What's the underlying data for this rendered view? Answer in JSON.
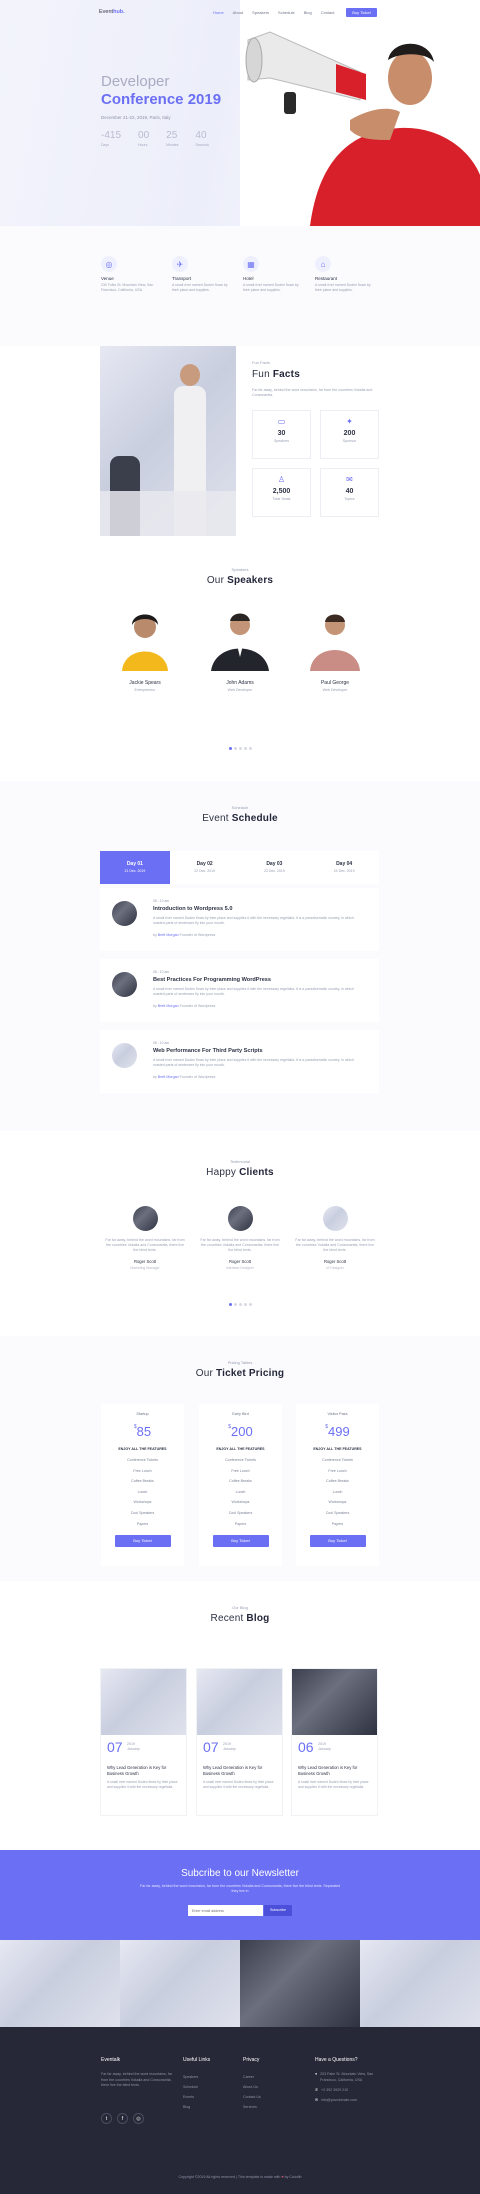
{
  "header": {
    "logo_main": "Event",
    "logo_accent": "hub.",
    "nav": [
      "Home",
      "About",
      "Speakers",
      "Schedule",
      "Blog",
      "Contact"
    ],
    "cta": "Buy Ticket"
  },
  "hero": {
    "title_line1": "Developer",
    "title_line2": "Conference 2019",
    "date": "December 21-22, 2019, Paris, Italy",
    "countdown": [
      {
        "value": "-415",
        "label": "Days"
      },
      {
        "value": "00",
        "label": "Hours"
      },
      {
        "value": "25",
        "label": "Minutes"
      },
      {
        "value": "40",
        "label": "Seconds"
      }
    ]
  },
  "features": [
    {
      "icon": "venue-icon",
      "glyph": "◎",
      "title": "Venue",
      "desc": "230 Folks St. Mountain View, San Francisco, California, USA"
    },
    {
      "icon": "transport-icon",
      "glyph": "✈",
      "title": "Transport",
      "desc": "A small river named Duden flows by their place and supplies."
    },
    {
      "icon": "hotel-icon",
      "glyph": "▦",
      "title": "Hotel",
      "desc": "A small river named Duden flows by their place and supplies."
    },
    {
      "icon": "restaurant-icon",
      "glyph": "⌂",
      "title": "Restaurant",
      "desc": "A small river named Duden flows by their place and supplies."
    }
  ],
  "facts": {
    "kicker": "Fun Facts",
    "title_light": "Fun",
    "title_bold": "Facts",
    "desc": "Far far away, behind the word mountains, far from the countries Vokalia and Consonantia.",
    "items": [
      {
        "icon": "ticket-icon",
        "glyph": "▭",
        "number": "30",
        "label": "Speakers"
      },
      {
        "icon": "sponsor-icon",
        "glyph": "✦",
        "number": "200",
        "label": "Sponsor"
      },
      {
        "icon": "seat-icon",
        "glyph": "♙",
        "number": "2,500",
        "label": "Total Seats"
      },
      {
        "icon": "topics-icon",
        "glyph": "✉",
        "number": "40",
        "label": "Topics"
      }
    ]
  },
  "speakers": {
    "kicker": "Speakers",
    "title_light": "Our",
    "title_bold": "Speakers",
    "items": [
      {
        "name": "Jackie Spears",
        "role": "Entrepreneur"
      },
      {
        "name": "John Adams",
        "role": "Web Developer"
      },
      {
        "name": "Paul George",
        "role": "Web Developer"
      }
    ]
  },
  "schedule": {
    "kicker": "Schedule",
    "title_light": "Event",
    "title_bold": "Schedule",
    "tabs": [
      {
        "day": "Day 01",
        "date": "21 Dec. 2019"
      },
      {
        "day": "Day 02",
        "date": "22 Dec. 2019"
      },
      {
        "day": "Day 03",
        "date": "23 Dec. 2019"
      },
      {
        "day": "Day 04",
        "date": "24 Dec. 2019"
      }
    ],
    "sessions": [
      {
        "time": "08 - 10 am",
        "title": "Introduction to Wordpress 5.0",
        "desc": "A small river named Duden flows by their place and supplies it with the necessary regelialia. It is a paradisematic country, in which roasted parts of sentences fly into your mouth.",
        "by_label": "by",
        "speaker": "Brett Morgan",
        "speaker_role": "Founder of Wordpress"
      },
      {
        "time": "08 - 10 am",
        "title": "Best Practices For Programming WordPress",
        "desc": "A small river named Duden flows by their place and supplies it with the necessary regelialia. It is a paradisematic country, in which roasted parts of sentences fly into your mouth.",
        "by_label": "by",
        "speaker": "Brett Morgan",
        "speaker_role": "Founder of Wordpress"
      },
      {
        "time": "08 - 10 am",
        "title": "Web Performance For Third Party Scripts",
        "desc": "A small river named Duden flows by their place and supplies it with the necessary regelialia. It is a paradisematic country, in which roasted parts of sentences fly into your mouth.",
        "by_label": "by",
        "speaker": "Brett Morgan",
        "speaker_role": "Founder of Wordpress"
      }
    ]
  },
  "clients": {
    "kicker": "Testimonial",
    "title_light": "Happy",
    "title_bold": "Clients",
    "items": [
      {
        "quote": "Far far away, behind the word mountains, far from the countries Vokalia and Consonantia, there live the blind texts.",
        "name": "Roger Scott",
        "role": "Marketing Manager"
      },
      {
        "quote": "Far far away, behind the word mountains, far from the countries Vokalia and Consonantia, there live the blind texts.",
        "name": "Roger Scott",
        "role": "Interface Designer"
      },
      {
        "quote": "Far far away, behind the word mountains, far from the countries Vokalia and Consonantia, there live the blind texts.",
        "name": "Roger Scott",
        "role": "UI Designer"
      }
    ]
  },
  "pricing": {
    "kicker": "Pricing Tables",
    "title_light": "Our",
    "title_bold": "Ticket Pricing",
    "plans": [
      {
        "name": "Startup",
        "currency": "$",
        "price": "85",
        "entry": "ENJOY ALL THE FEATURES",
        "features": [
          "Conference Tickets",
          "Free Lunch",
          "Coffee Breaks",
          "Lunch",
          "Workshops",
          "Cool Speakers",
          "Papers"
        ],
        "button": "Buy Ticket"
      },
      {
        "name": "Early Bird",
        "currency": "$",
        "price": "200",
        "entry": "ENJOY ALL THE FEATURES",
        "features": [
          "Conference Tickets",
          "Free Lunch",
          "Coffee Breaks",
          "Lunch",
          "Workshops",
          "Cool Speakers",
          "Papers"
        ],
        "button": "Buy Ticket"
      },
      {
        "name": "Visitor Pass",
        "currency": "$",
        "price": "499",
        "entry": "ENJOY ALL THE FEATURES",
        "features": [
          "Conference Tickets",
          "Free Lunch",
          "Coffee Breaks",
          "Lunch",
          "Workshops",
          "Cool Speakers",
          "Papers"
        ],
        "button": "Buy Ticket"
      }
    ]
  },
  "blog": {
    "kicker": "Our Blog",
    "title_light": "Recent",
    "title_bold": "Blog",
    "posts": [
      {
        "day": "07",
        "year": "2019",
        "month": "January",
        "title": "Why Lead Generation is Key for Business Growth",
        "desc": "A small river named Duden flows by their place and supplies it with the necessary regelialia."
      },
      {
        "day": "07",
        "year": "2019",
        "month": "January",
        "title": "Why Lead Generation is Key for Business Growth",
        "desc": "A small river named Duden flows by their place and supplies it with the necessary regelialia."
      },
      {
        "day": "06",
        "year": "2019",
        "month": "January",
        "title": "Why Lead Generation is Key for Business Growth",
        "desc": "A small river named Duden flows by their place and supplies it with the necessary regelialia."
      }
    ]
  },
  "newsletter": {
    "title": "Subcribe to our Newsletter",
    "desc": "Far far away, behind the word mountains, far from the countries Vokalia and Consonantia, there live the blind texts. Separated they live in",
    "placeholder": "Enter email address",
    "button": "Subscribe"
  },
  "footer": {
    "about_title": "Eventalk",
    "about_text": "Far far away, behind the word mountains, far from the countries Vokalia and Consonantia, there live the blind texts.",
    "social": [
      "twitter-icon",
      "facebook-icon",
      "instagram-icon"
    ],
    "useful_title": "Useful Links",
    "useful_links": [
      "Speakers",
      "Schedule",
      "Events",
      "Blog"
    ],
    "privacy_title": "Privacy",
    "privacy_links": [
      "Career",
      "About Us",
      "Contact Us",
      "Services"
    ],
    "question_title": "Have a Questions?",
    "address": "203 Fake St. Mountain View, San Francisco, California, USA",
    "phone": "+2 392 3929 210",
    "email": "info@yourdomain.com",
    "copyright": "Copyright ©2019 All rights reserved | This template is made with",
    "copyright_by": "by Colorlib"
  },
  "colors": {
    "accent": "#6b6ff3",
    "dark": "#262837",
    "hero_red": "#d8202a"
  }
}
